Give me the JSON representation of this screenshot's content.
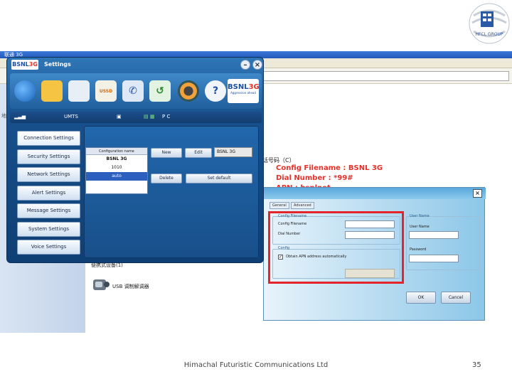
{
  "logo": {
    "text": "HFCL GROUP"
  },
  "host": {
    "titlebar_text": "联通 3G",
    "side_label": "地",
    "chinese_line": "话号码（C）",
    "device_label": "便携式设备(1)",
    "usb_label": "USB 调制解调器"
  },
  "settings_window": {
    "brand_prefix": "BSNL",
    "brand_suffix": "3G",
    "title": "Settings",
    "min_label": "–",
    "close_label": "×",
    "toolbar_logo_line1_prefix": "BSNL",
    "toolbar_logo_line1_suffix": "3G",
    "toolbar_logo_line2": "Aggression ahead",
    "toolbar_icon_sms": "USSD",
    "status": {
      "network": "UMTS",
      "mode": "P C"
    },
    "menu": [
      "Connection Settings",
      "Security Settings",
      "Network Settings",
      "Alert Settings",
      "Message Settings",
      "System Settings",
      "Voice Settings"
    ],
    "list_header": "Configuration name",
    "list_rows": [
      "BSNL 3G",
      "1010",
      "auto"
    ],
    "buttons": {
      "new": "New",
      "edit": "Edit",
      "delete": "Delete",
      "set_default": "Set default"
    },
    "current_config_value": "BSNL 3G"
  },
  "annotations": {
    "line1": "Config Filename : BSNL 3G",
    "line2": "Dial Number : *99#",
    "line3": "APN : bsnlnet"
  },
  "dialog": {
    "close_label": "×",
    "tabs": [
      "General",
      "Advanced"
    ],
    "config_filename_group": "Config Filename",
    "config_filename_label": "Config Filename",
    "dial_number_label": "Dial Number",
    "user_name_group": "User Name",
    "user_name_label": "User Name",
    "password_label": "Password",
    "config_group": "Config",
    "auto_apn_label": "Obtain APN address automatically",
    "check_mark": "✓",
    "ok_label": "OK",
    "cancel_label": "Cancel"
  },
  "footer": {
    "company": "Himachal Futuristic Communications Ltd",
    "page_number": "35"
  },
  "colors": {
    "accent_red": "#e8302a",
    "window_blue": "#16508c",
    "dialog_blue": "#8cc7e8"
  }
}
